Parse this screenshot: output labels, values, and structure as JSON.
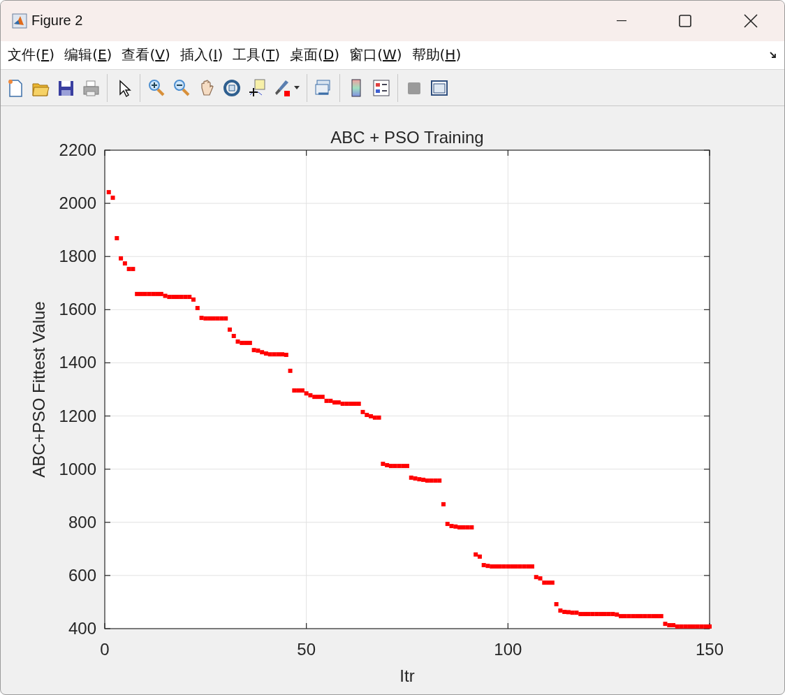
{
  "window": {
    "title": "Figure 2"
  },
  "menu": [
    {
      "before": "文件(",
      "key": "F",
      "after": ")"
    },
    {
      "before": "编辑(",
      "key": "E",
      "after": ")"
    },
    {
      "before": "查看(",
      "key": "V",
      "after": ")"
    },
    {
      "before": "插入(",
      "key": "I",
      "after": ")"
    },
    {
      "before": "工具(",
      "key": "T",
      "after": ")"
    },
    {
      "before": "桌面(",
      "key": "D",
      "after": ")"
    },
    {
      "before": "窗口(",
      "key": "W",
      "after": ")"
    },
    {
      "before": "帮助(",
      "key": "H",
      "after": ")"
    }
  ],
  "chart_data": {
    "type": "scatter",
    "title": "ABC + PSO Training",
    "xlabel": "Itr",
    "ylabel": "ABC+PSO Fittest Value",
    "xlim": [
      0,
      150
    ],
    "ylim": [
      400,
      2200
    ],
    "xticks": [
      0,
      50,
      100,
      150
    ],
    "yticks": [
      400,
      600,
      800,
      1000,
      1200,
      1400,
      1600,
      1800,
      2000,
      2200
    ],
    "grid": true,
    "series": [
      {
        "color": "#ff0000",
        "x": [
          1,
          2,
          3,
          4,
          5,
          6,
          7,
          8,
          9,
          10,
          11,
          12,
          13,
          14,
          15,
          16,
          17,
          18,
          19,
          20,
          21,
          22,
          23,
          24,
          25,
          26,
          27,
          28,
          29,
          30,
          31,
          32,
          33,
          34,
          35,
          36,
          37,
          38,
          39,
          40,
          41,
          42,
          43,
          44,
          45,
          46,
          47,
          48,
          49,
          50,
          51,
          52,
          53,
          54,
          55,
          56,
          57,
          58,
          59,
          60,
          61,
          62,
          63,
          64,
          65,
          66,
          67,
          68,
          69,
          70,
          71,
          72,
          73,
          74,
          75,
          76,
          77,
          78,
          79,
          80,
          81,
          82,
          83,
          84,
          85,
          86,
          87,
          88,
          89,
          90,
          91,
          92,
          93,
          94,
          95,
          96,
          97,
          98,
          99,
          100,
          101,
          102,
          103,
          104,
          105,
          106,
          107,
          108,
          109,
          110,
          111,
          112,
          113,
          114,
          115,
          116,
          117,
          118,
          119,
          120,
          121,
          122,
          123,
          124,
          125,
          126,
          127,
          128,
          129,
          130,
          131,
          132,
          133,
          134,
          135,
          136,
          137,
          138,
          139,
          140,
          141,
          142,
          143,
          144,
          145,
          146,
          147,
          148,
          149,
          150
        ],
        "values": [
          2042,
          2021,
          1869,
          1793,
          1774,
          1753,
          1753,
          1659,
          1659,
          1659,
          1659,
          1659,
          1659,
          1659,
          1652,
          1648,
          1648,
          1648,
          1648,
          1648,
          1648,
          1638,
          1606,
          1569,
          1567,
          1567,
          1567,
          1567,
          1567,
          1567,
          1525,
          1501,
          1480,
          1475,
          1475,
          1475,
          1448,
          1446,
          1440,
          1435,
          1432,
          1432,
          1432,
          1432,
          1430,
          1370,
          1296,
          1296,
          1296,
          1285,
          1278,
          1272,
          1272,
          1272,
          1257,
          1257,
          1251,
          1251,
          1246,
          1246,
          1246,
          1246,
          1246,
          1215,
          1204,
          1199,
          1194,
          1194,
          1020,
          1015,
          1012,
          1012,
          1012,
          1012,
          1012,
          968,
          965,
          962,
          960,
          957,
          957,
          957,
          957,
          868,
          794,
          786,
          784,
          781,
          781,
          781,
          781,
          679,
          671,
          639,
          636,
          634,
          634,
          634,
          634,
          634,
          634,
          634,
          634,
          634,
          634,
          634,
          594,
          589,
          573,
          573,
          573,
          492,
          468,
          463,
          462,
          460,
          460,
          455,
          455,
          455,
          455,
          455,
          455,
          455,
          455,
          455,
          453,
          447,
          447,
          447,
          447,
          447,
          447,
          447,
          447,
          447,
          447,
          447,
          418,
          413,
          413,
          408,
          408,
          408,
          408,
          408,
          408,
          408,
          408,
          408
        ]
      }
    ]
  }
}
